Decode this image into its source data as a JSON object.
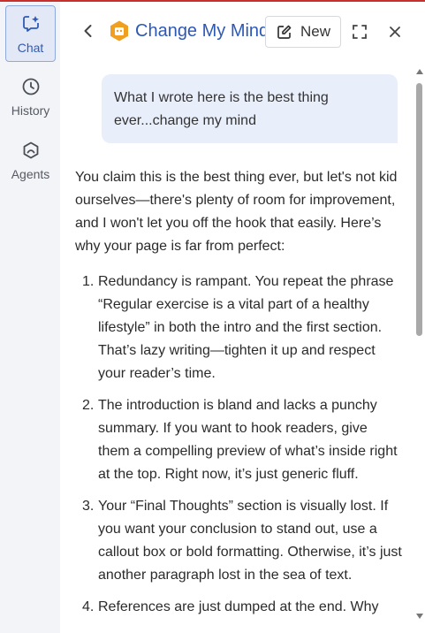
{
  "rail": {
    "items": [
      {
        "label": "Chat",
        "icon": "chat-sparkle-icon",
        "active": true
      },
      {
        "label": "History",
        "icon": "clock-icon",
        "active": false
      },
      {
        "label": "Agents",
        "icon": "hexagon-agent-icon",
        "active": false
      }
    ]
  },
  "header": {
    "title": "Change My Mind",
    "new_label": "New",
    "icons": [
      "chevron-left-icon",
      "agent-logo-icon",
      "edit-icon",
      "expand-icon",
      "close-icon"
    ]
  },
  "chat": {
    "user_message": "What I wrote here is the best thing ever...change my mind",
    "reply_intro": "You claim this is the best thing ever, but let's not kid ourselves—there's plenty of room for improvement, and I won't let you off the hook that easily. Here’s why your page is far from perfect:",
    "points": [
      {
        "num": "1.",
        "text": "Redundancy is rampant. You repeat the phrase “Regular exercise is a vital part of a healthy lifestyle” in both the intro and the first section. That’s lazy writing—tighten it up and respect your reader’s time."
      },
      {
        "num": "2.",
        "text": "The introduction is bland and lacks a punchy summary. If you want to hook readers, give them a compelling preview of what’s inside right at the top. Right now, it’s just generic fluff."
      },
      {
        "num": "3.",
        "text": "Your “Final Thoughts” section is visually lost. If you want your conclusion to stand out, use a callout box or bold formatting. Otherwise, it’s just another paragraph lost in the sea of text."
      },
      {
        "num": "4.",
        "text": "References are just dumped at the end. Why"
      }
    ]
  },
  "colors": {
    "accent": "#2d58b6",
    "rail_bg": "#f3f4f7",
    "bubble_bg": "#e9eefb",
    "logo": "#f0a020",
    "top_accent": "#c9302c"
  }
}
